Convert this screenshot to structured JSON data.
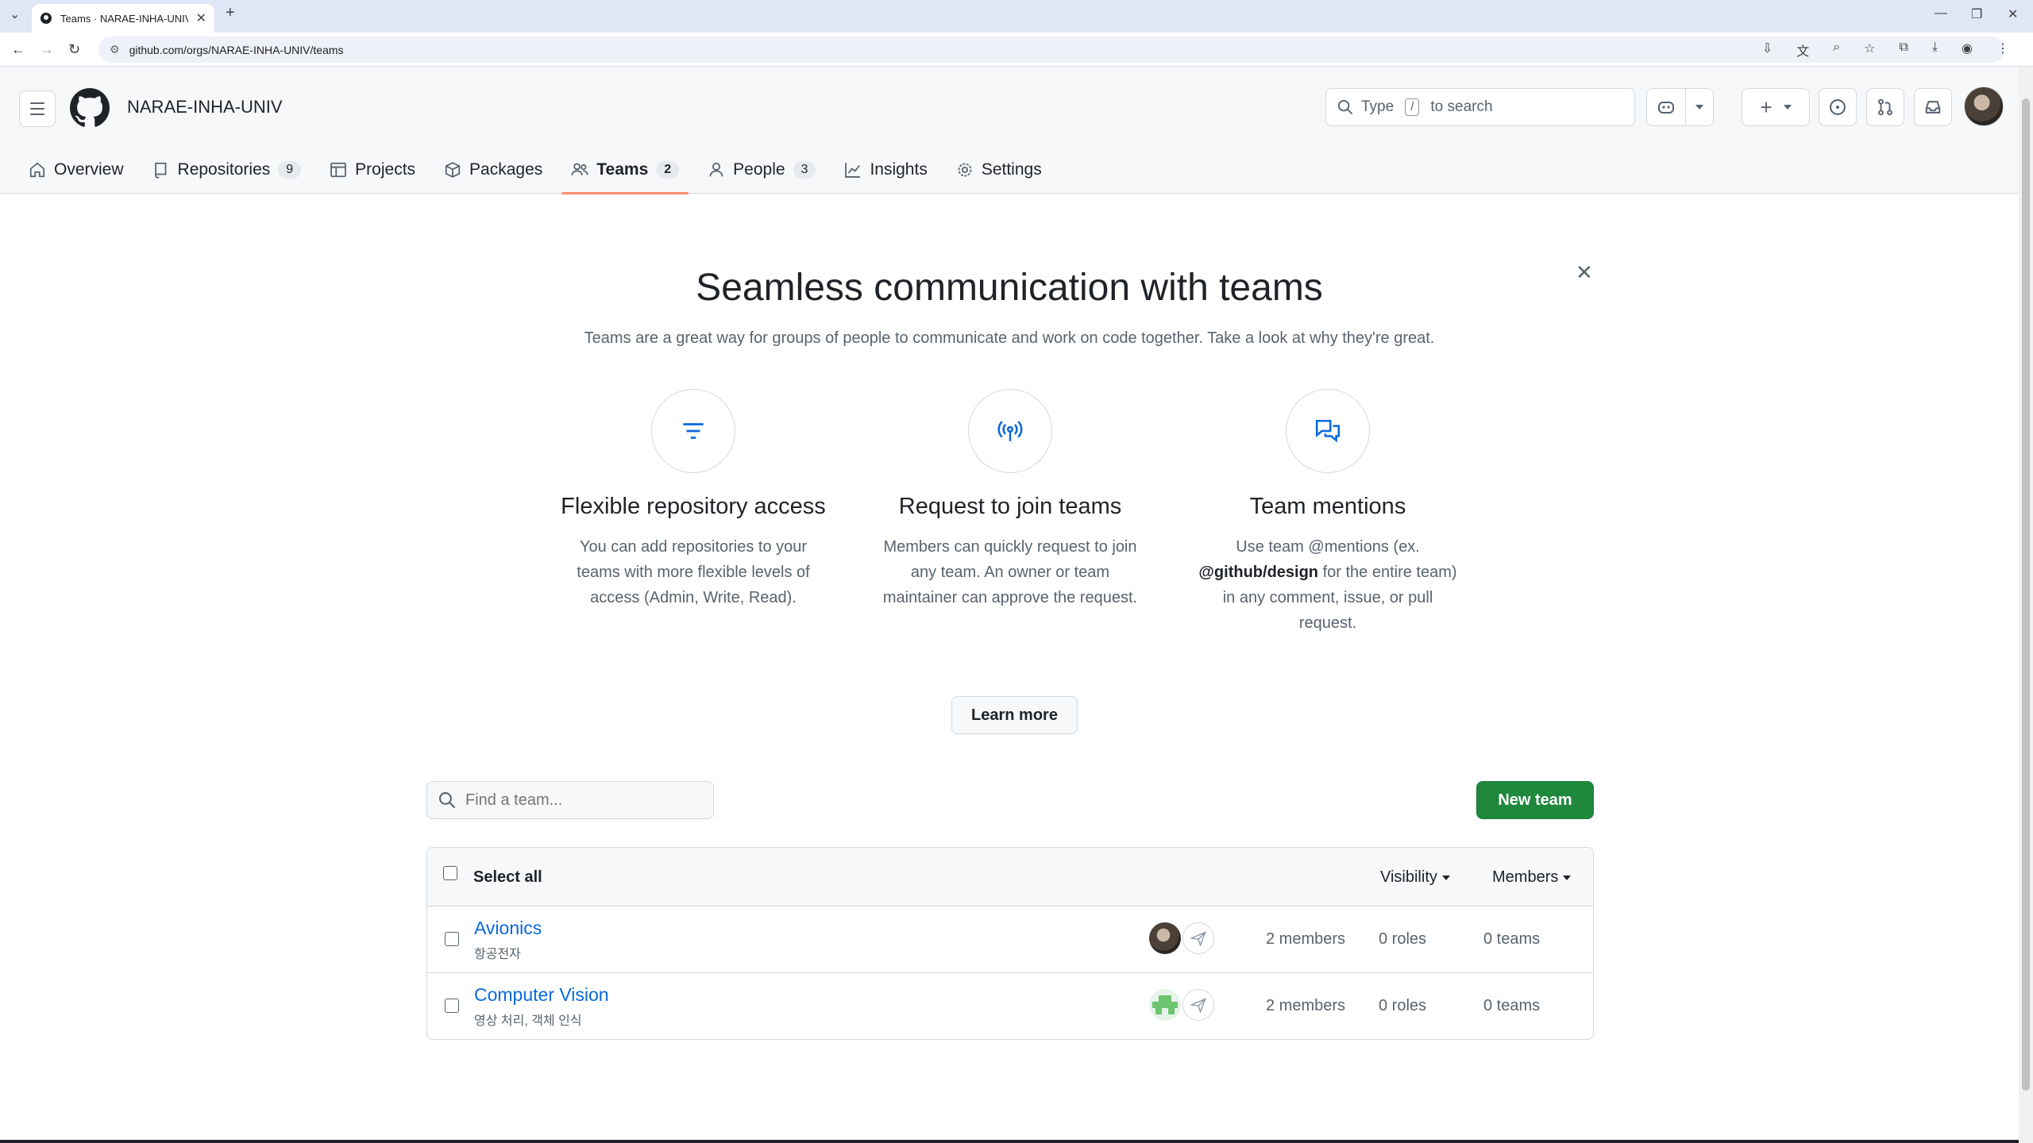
{
  "browser": {
    "tab_title": "Teams · NARAE-INHA-UNIV",
    "url": "github.com/orgs/NARAE-INHA-UNIV/teams"
  },
  "header": {
    "org_name": "NARAE-INHA-UNIV",
    "search_prefix": "Type",
    "search_key": "/",
    "search_suffix": "to search"
  },
  "tabs": [
    {
      "label": "Overview",
      "icon": "home-icon"
    },
    {
      "label": "Repositories",
      "count": "9",
      "icon": "repo-icon"
    },
    {
      "label": "Projects",
      "icon": "table-icon"
    },
    {
      "label": "Packages",
      "icon": "package-icon"
    },
    {
      "label": "Teams",
      "count": "2",
      "icon": "people-icon",
      "active": true
    },
    {
      "label": "People",
      "count": "3",
      "icon": "person-icon"
    },
    {
      "label": "Insights",
      "icon": "graph-icon"
    },
    {
      "label": "Settings",
      "icon": "gear-icon"
    }
  ],
  "intro": {
    "title": "Seamless communication with teams",
    "subtitle": "Teams are a great way for groups of people to communicate and work on code together. Take a look at why they're great.",
    "features": [
      {
        "title": "Flexible repository access",
        "desc": "You can add repositories to your teams with more flexible levels of access (Admin, Write, Read).",
        "icon": "filter-icon"
      },
      {
        "title": "Request to join teams",
        "desc": "Members can quickly request to join any team. An owner or team maintainer can approve the request.",
        "icon": "broadcast-icon"
      },
      {
        "title": "Team mentions",
        "desc_pre": "Use team @mentions (ex.",
        "desc_bold": "@github/design",
        "desc_post": "for the entire team) in any comment, issue, or pull request.",
        "icon": "comment-discussion-icon"
      }
    ],
    "learn_more": "Learn more"
  },
  "teams_list": {
    "search_placeholder": "Find a team...",
    "new_team": "New team",
    "select_all": "Select all",
    "visibility": "Visibility",
    "members": "Members",
    "rows": [
      {
        "name": "Avionics",
        "desc": "항공전자",
        "members": "2 members",
        "roles": "0 roles",
        "teams": "0 teams"
      },
      {
        "name": "Computer Vision",
        "desc": "영상 처리, 객체 인식",
        "members": "2 members",
        "roles": "0 roles",
        "teams": "0 teams"
      }
    ]
  },
  "colors": {
    "accent": "#0969da",
    "primary_button": "#1f883d",
    "tab_underline": "#fd8c73"
  }
}
